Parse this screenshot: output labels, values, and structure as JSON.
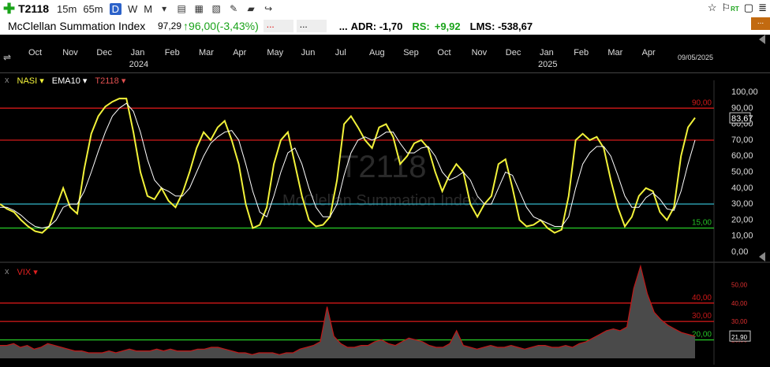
{
  "toolbar": {
    "symbol": "T2118",
    "timeframes": [
      "15m",
      "65m",
      "D",
      "W",
      "M"
    ],
    "active_timeframe": "D",
    "right_rt": "RT"
  },
  "infobar": {
    "name": "McClellan Summation Index",
    "last": "97,29",
    "change": "96,00(-3,43%)",
    "dots1": "...",
    "dots2": "...",
    "dots3": "...",
    "adr": "ADR: -1,70",
    "rs_label": "RS:",
    "rs_value": "+9,92",
    "lms": "LMS: -538,67",
    "corner": "..."
  },
  "time_axis": {
    "months": [
      "Oct",
      "Nov",
      "Dec",
      "Jan",
      "Feb",
      "Mar",
      "Apr",
      "May",
      "Jun",
      "Jul",
      "Aug",
      "Sep",
      "Oct",
      "Nov",
      "Dec",
      "Jan",
      "Feb",
      "Mar",
      "Apr"
    ],
    "years": [
      {
        "label": "2024",
        "month_index": 3
      },
      {
        "label": "2025",
        "month_index": 15
      }
    ],
    "date_label": "09/05/2025"
  },
  "watermark": {
    "symbol": "T2118",
    "name": "McClellan Summation Index"
  },
  "chart_data": [
    {
      "type": "line",
      "legend": [
        "NASI",
        "EMA10",
        "T2118"
      ],
      "ylim": [
        0,
        100
      ],
      "yticks": [
        "100,00",
        "90,00",
        "80,00",
        "70,00",
        "60,00",
        "50,00",
        "40,00",
        "30,00",
        "20,00",
        "10,00",
        "0,00"
      ],
      "last_value_label": "83,67",
      "hlines": [
        {
          "value": 90,
          "label": "90,00",
          "color": "#d01818"
        },
        {
          "value": 70,
          "color": "#c01818"
        },
        {
          "value": 30,
          "color": "#2fa6b8"
        },
        {
          "value": 15,
          "label": "15,00",
          "color": "#25c025"
        }
      ],
      "series": [
        {
          "name": "NASI",
          "color": "#f2f23a",
          "values": [
            30,
            27,
            25,
            20,
            16,
            13,
            12,
            16,
            28,
            40,
            28,
            24,
            52,
            74,
            85,
            91,
            94,
            96,
            96,
            75,
            50,
            35,
            33,
            40,
            32,
            28,
            37,
            50,
            65,
            75,
            70,
            78,
            82,
            70,
            55,
            30,
            15,
            17,
            28,
            55,
            70,
            75,
            55,
            35,
            20,
            16,
            17,
            22,
            45,
            80,
            85,
            78,
            70,
            65,
            78,
            80,
            72,
            55,
            60,
            68,
            70,
            65,
            50,
            38,
            48,
            55,
            50,
            30,
            22,
            30,
            35,
            55,
            58,
            40,
            20,
            16,
            17,
            20,
            15,
            12,
            14,
            35,
            70,
            74,
            70,
            72,
            65,
            45,
            28,
            16,
            22,
            35,
            40,
            38,
            25,
            20,
            28,
            60,
            78,
            84
          ]
        },
        {
          "name": "EMA10",
          "color": "#ffffff",
          "values": [
            28,
            28,
            26,
            23,
            19,
            16,
            15,
            16,
            20,
            28,
            30,
            30,
            38,
            50,
            63,
            75,
            85,
            90,
            93,
            88,
            75,
            58,
            45,
            40,
            38,
            35,
            35,
            40,
            50,
            60,
            68,
            72,
            75,
            76,
            70,
            55,
            38,
            25,
            22,
            35,
            50,
            62,
            65,
            55,
            40,
            28,
            22,
            22,
            30,
            48,
            62,
            70,
            72,
            70,
            72,
            75,
            75,
            68,
            62,
            62,
            65,
            66,
            60,
            50,
            45,
            47,
            50,
            45,
            35,
            30,
            30,
            40,
            50,
            48,
            38,
            28,
            22,
            20,
            18,
            16,
            16,
            22,
            40,
            55,
            62,
            66,
            66,
            60,
            48,
            35,
            28,
            28,
            34,
            37,
            33,
            27,
            26,
            38,
            55,
            70
          ]
        }
      ]
    },
    {
      "type": "area",
      "legend": [
        "VIX"
      ],
      "ylim": [
        10,
        60
      ],
      "yticks": [
        "50,00",
        "40,00",
        "30,00",
        "20,00"
      ],
      "last_value_label": "21,90",
      "hlines": [
        {
          "value": 40,
          "label": "40,00",
          "color": "#d01818"
        },
        {
          "value": 30,
          "label": "30,00",
          "color": "#c01818"
        },
        {
          "value": 20,
          "label": "20,00",
          "color": "#25c025"
        }
      ],
      "series": [
        {
          "name": "VIX",
          "color": "#c01818",
          "values": [
            17,
            17,
            18,
            16,
            17,
            15,
            16,
            18,
            17,
            16,
            15,
            14,
            14,
            13,
            13,
            13,
            14,
            13,
            14,
            15,
            14,
            14,
            14,
            15,
            14,
            15,
            14,
            14,
            14,
            15,
            15,
            16,
            16,
            15,
            14,
            13,
            13,
            12,
            13,
            13,
            13,
            12,
            13,
            13,
            15,
            16,
            17,
            19,
            38,
            22,
            18,
            16,
            16,
            17,
            17,
            19,
            20,
            18,
            17,
            19,
            21,
            20,
            19,
            17,
            16,
            16,
            18,
            25,
            17,
            16,
            15,
            16,
            17,
            16,
            16,
            17,
            16,
            15,
            16,
            17,
            17,
            16,
            16,
            17,
            16,
            18,
            19,
            21,
            23,
            25,
            26,
            25,
            27,
            48,
            60,
            45,
            35,
            31,
            28,
            26,
            24,
            23,
            22
          ]
        }
      ]
    }
  ]
}
